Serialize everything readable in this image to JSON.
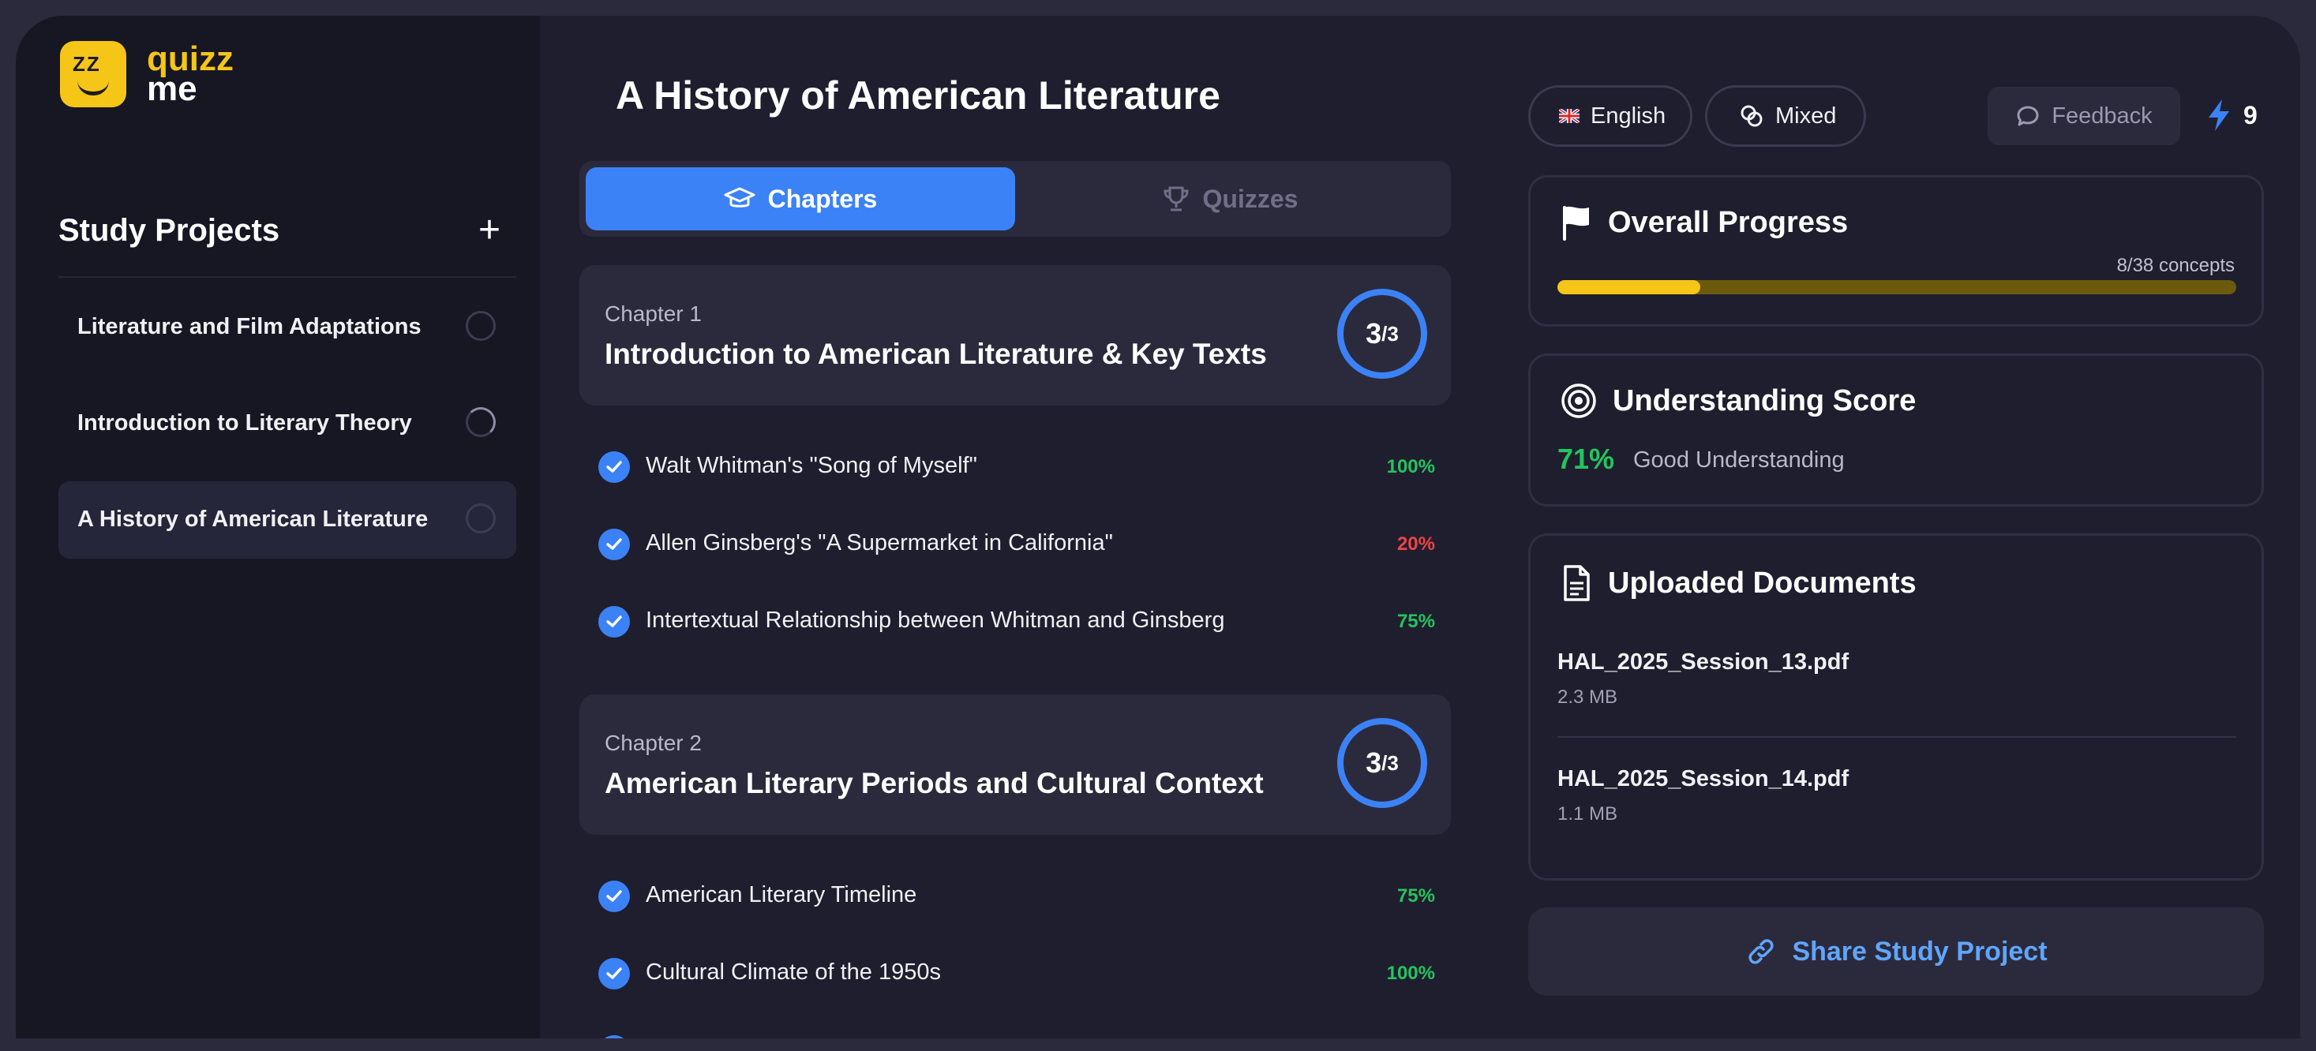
{
  "app": {
    "logo_line1": "quizz",
    "logo_line2": "me",
    "logo_mark": "ZZ"
  },
  "sidebar": {
    "title": "Study Projects",
    "add_label": "+",
    "projects": [
      {
        "label": "Literature and Film Adaptations"
      },
      {
        "label": "Introduction to Literary Theory"
      },
      {
        "label": "A History of American Literature"
      }
    ]
  },
  "main": {
    "title": "A History of American Literature",
    "tabs": [
      {
        "label": "Chapters"
      },
      {
        "label": "Quizzes"
      }
    ],
    "chapters": [
      {
        "number": "Chapter 1",
        "title": "Introduction to American Literature & Key Texts",
        "done": "3",
        "total": "/3",
        "concepts": [
          {
            "label": "Walt Whitman's \"Song of Myself\"",
            "pct": "100%"
          },
          {
            "label": "Allen Ginsberg's \"A Supermarket in California\"",
            "pct": "20%"
          },
          {
            "label": "Intertextual Relationship between Whitman and Ginsberg",
            "pct": "75%"
          }
        ]
      },
      {
        "number": "Chapter 2",
        "title": "American Literary Periods and Cultural Context",
        "done": "3",
        "total": "/3",
        "concepts": [
          {
            "label": "American Literary Timeline",
            "pct": "75%"
          },
          {
            "label": "Cultural Climate of the 1950s",
            "pct": "100%"
          }
        ]
      }
    ]
  },
  "toolbar": {
    "language": "English",
    "mode": "Mixed",
    "feedback": "Feedback",
    "energy": "9"
  },
  "progress": {
    "title": "Overall Progress",
    "count": "8/38 concepts",
    "fraction": 0.21
  },
  "understanding": {
    "title": "Understanding Score",
    "value": "71%",
    "label": "Good Understanding"
  },
  "documents": {
    "title": "Uploaded Documents",
    "items": [
      {
        "name": "HAL_2025_Session_13.pdf",
        "size": "2.3 MB"
      },
      {
        "name": "HAL_2025_Session_14.pdf",
        "size": "1.1 MB"
      }
    ]
  },
  "share": {
    "label": "Share Study Project"
  },
  "colors": {
    "accent": "#3b82f6",
    "brand": "#f5c518",
    "good": "#22c55e",
    "bad": "#ef4444"
  }
}
